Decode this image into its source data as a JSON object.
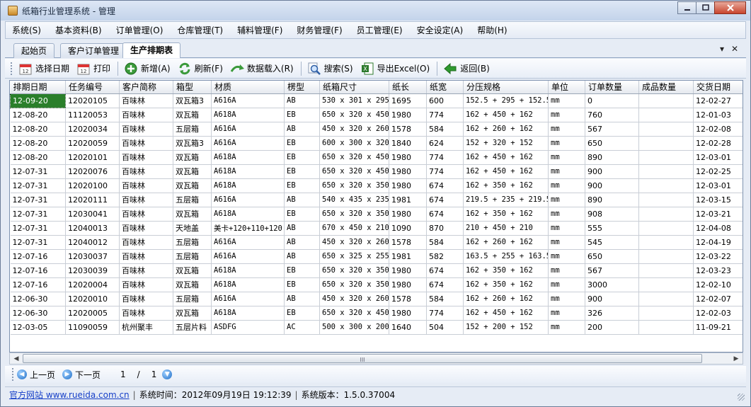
{
  "window": {
    "title": "纸箱行业管理系统 - 管理"
  },
  "menu": [
    "系统(S)",
    "基本资料(B)",
    "订单管理(O)",
    "仓库管理(T)",
    "辅料管理(F)",
    "财务管理(F)",
    "员工管理(E)",
    "安全设定(A)",
    "帮助(H)"
  ],
  "tabs": [
    {
      "label": "起始页",
      "active": false
    },
    {
      "label": "客户订单管理",
      "active": false
    },
    {
      "label": "生产排期表",
      "active": true
    }
  ],
  "tab_controls": {
    "dropdown": "▾",
    "close": "✕"
  },
  "toolbar": {
    "select_date": "选择日期",
    "print": "打印",
    "add": "新增(A)",
    "refresh": "刷新(F)",
    "load_data": "数据载入(R)",
    "search": "搜索(S)",
    "export_excel": "导出Excel(O)",
    "back": "返回(B)"
  },
  "grid": {
    "columns": [
      "排期日期",
      "任务编号",
      "客户简称",
      "箱型",
      "材质",
      "楞型",
      "纸箱尺寸",
      "纸长",
      "纸宽",
      "分压规格",
      "单位",
      "订单数量",
      "成品数量",
      "交货日期"
    ],
    "rows": [
      [
        "12-09-20",
        "12020105",
        "百味林",
        "双瓦箱3",
        "A616A",
        "AB",
        "530 x 301 x 295",
        "1695",
        "600",
        "152.5 + 295 + 152.5",
        "mm",
        "0",
        "",
        "12-02-27"
      ],
      [
        "12-08-20",
        "11120053",
        "百味林",
        "双瓦箱",
        "A618A",
        "EB",
        "650 x 320 x 450",
        "1980",
        "774",
        "162 + 450 + 162",
        "mm",
        "760",
        "",
        "12-01-03"
      ],
      [
        "12-08-20",
        "12020034",
        "百味林",
        "五层箱",
        "A616A",
        "AB",
        "450 x 320 x 260",
        "1578",
        "584",
        "162 + 260 + 162",
        "mm",
        "567",
        "",
        "12-02-08"
      ],
      [
        "12-08-20",
        "12020059",
        "百味林",
        "双瓦箱3",
        "A616A",
        "EB",
        "600 x 300 x 320",
        "1840",
        "624",
        "152 + 320 + 152",
        "mm",
        "650",
        "",
        "12-02-28"
      ],
      [
        "12-08-20",
        "12020101",
        "百味林",
        "双瓦箱",
        "A618A",
        "EB",
        "650 x 320 x 450",
        "1980",
        "774",
        "162 + 450 + 162",
        "mm",
        "890",
        "",
        "12-03-01"
      ],
      [
        "12-07-31",
        "12020076",
        "百味林",
        "双瓦箱",
        "A618A",
        "EB",
        "650 x 320 x 450",
        "1980",
        "774",
        "162 + 450 + 162",
        "mm",
        "900",
        "",
        "12-02-25"
      ],
      [
        "12-07-31",
        "12020100",
        "百味林",
        "双瓦箱",
        "A618A",
        "EB",
        "650 x 320 x 350",
        "1980",
        "674",
        "162 + 350 + 162",
        "mm",
        "900",
        "",
        "12-03-01"
      ],
      [
        "12-07-31",
        "12020111",
        "百味林",
        "五层箱",
        "A616A",
        "AB",
        "540 x 435 x 235",
        "1981",
        "674",
        "219.5 + 235 + 219.5",
        "mm",
        "890",
        "",
        "12-03-15"
      ],
      [
        "12-07-31",
        "12030041",
        "百味林",
        "双瓦箱",
        "A618A",
        "EB",
        "650 x 320 x 350",
        "1980",
        "674",
        "162 + 350 + 162",
        "mm",
        "908",
        "",
        "12-03-21"
      ],
      [
        "12-07-31",
        "12040013",
        "百味林",
        "天地盖",
        "美卡+120+110+120",
        "AB",
        "670 x 450 x 210",
        "1090",
        "870",
        "210 + 450 + 210",
        "mm",
        "555",
        "",
        "12-04-08"
      ],
      [
        "12-07-31",
        "12040012",
        "百味林",
        "五层箱",
        "A616A",
        "AB",
        "450 x 320 x 260",
        "1578",
        "584",
        "162 + 260 + 162",
        "mm",
        "545",
        "",
        "12-04-19"
      ],
      [
        "12-07-16",
        "12030037",
        "百味林",
        "五层箱",
        "A616A",
        "AB",
        "650 x 325 x 255",
        "1981",
        "582",
        "163.5 + 255 + 163.5",
        "mm",
        "650",
        "",
        "12-03-22"
      ],
      [
        "12-07-16",
        "12030039",
        "百味林",
        "双瓦箱",
        "A618A",
        "EB",
        "650 x 320 x 350",
        "1980",
        "674",
        "162 + 350 + 162",
        "mm",
        "567",
        "",
        "12-03-23"
      ],
      [
        "12-07-16",
        "12020004",
        "百味林",
        "双瓦箱",
        "A618A",
        "EB",
        "650 x 320 x 350",
        "1980",
        "674",
        "162 + 350 + 162",
        "mm",
        "3000",
        "",
        "12-02-10"
      ],
      [
        "12-06-30",
        "12020010",
        "百味林",
        "五层箱",
        "A616A",
        "AB",
        "450 x 320 x 260",
        "1578",
        "584",
        "162 + 260 + 162",
        "mm",
        "900",
        "",
        "12-02-07"
      ],
      [
        "12-06-30",
        "12020005",
        "百味林",
        "双瓦箱",
        "A618A",
        "EB",
        "650 x 320 x 450",
        "1980",
        "774",
        "162 + 450 + 162",
        "mm",
        "326",
        "",
        "12-02-03"
      ],
      [
        "12-03-05",
        "11090059",
        "杭州聚丰",
        "五层片料",
        "ASDFG",
        "AC",
        "500 x 300 x 200",
        "1640",
        "504",
        "152 + 200 + 152",
        "mm",
        "200",
        "",
        "11-09-21"
      ]
    ]
  },
  "scrollbar": {
    "grip": "III"
  },
  "pager": {
    "prev": "上一页",
    "next": "下一页",
    "current_page": "1",
    "separator": "/",
    "total_pages": "1"
  },
  "status": {
    "website_label": "官方网站 www.rueida.com.cn",
    "system_time": "系统时间：2012年09月19日 19:12:39",
    "version": "系统版本：1.5.0.37004",
    "separator": "|"
  },
  "colors": {
    "selected_cell": "#2a7f2a",
    "link": "#1740c8"
  }
}
